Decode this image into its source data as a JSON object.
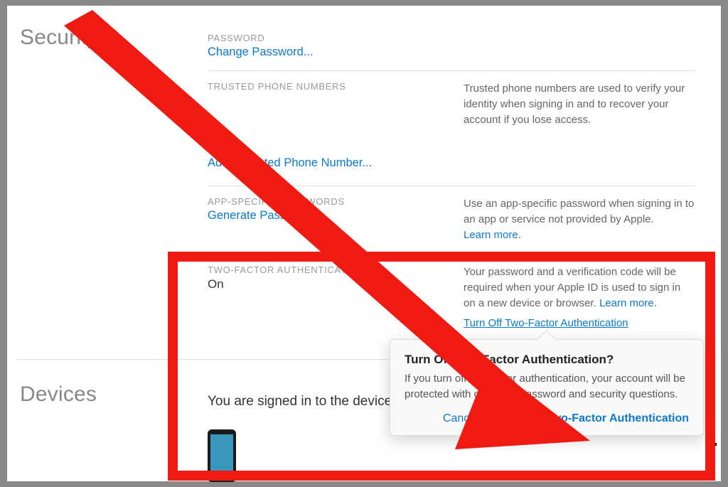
{
  "sections": {
    "security": {
      "title": "Security",
      "password": {
        "label": "PASSWORD",
        "change_link": "Change Password..."
      },
      "trusted": {
        "label": "TRUSTED PHONE NUMBERS",
        "help": "Trusted phone numbers are used to verify your identity when signing in and to recover your account if you lose access.",
        "add_link": "Add a Trusted Phone Number..."
      },
      "app_specific": {
        "label": "APP-SPECIFIC PASSWORDS",
        "generate_link": "Generate Password...",
        "help": "Use an app-specific password when signing in to an app or service not provided by Apple.",
        "learn_more": "Learn more."
      },
      "two_factor": {
        "label": "TWO-FACTOR AUTHENTICATION",
        "status": "On",
        "help_pre": "Your password and a verification code will be required when your Apple ID is used to sign in on a new device or browser. ",
        "learn_more": "Learn more.",
        "turn_off_link": "Turn Off Two-Factor Authentication"
      }
    },
    "devices": {
      "title": "Devices",
      "body": "You are signed in to the devices below."
    }
  },
  "popover": {
    "title": "Turn Off Two-Factor Authentication?",
    "body": "If you turn off two-factor authentication, your account will be protected with only your password and security questions.",
    "cancel": "Cancel",
    "confirm": "Turn Off Two-Factor Authentication"
  },
  "colors": {
    "accent": "#0b79cc",
    "annotation": "#ef1a11"
  }
}
